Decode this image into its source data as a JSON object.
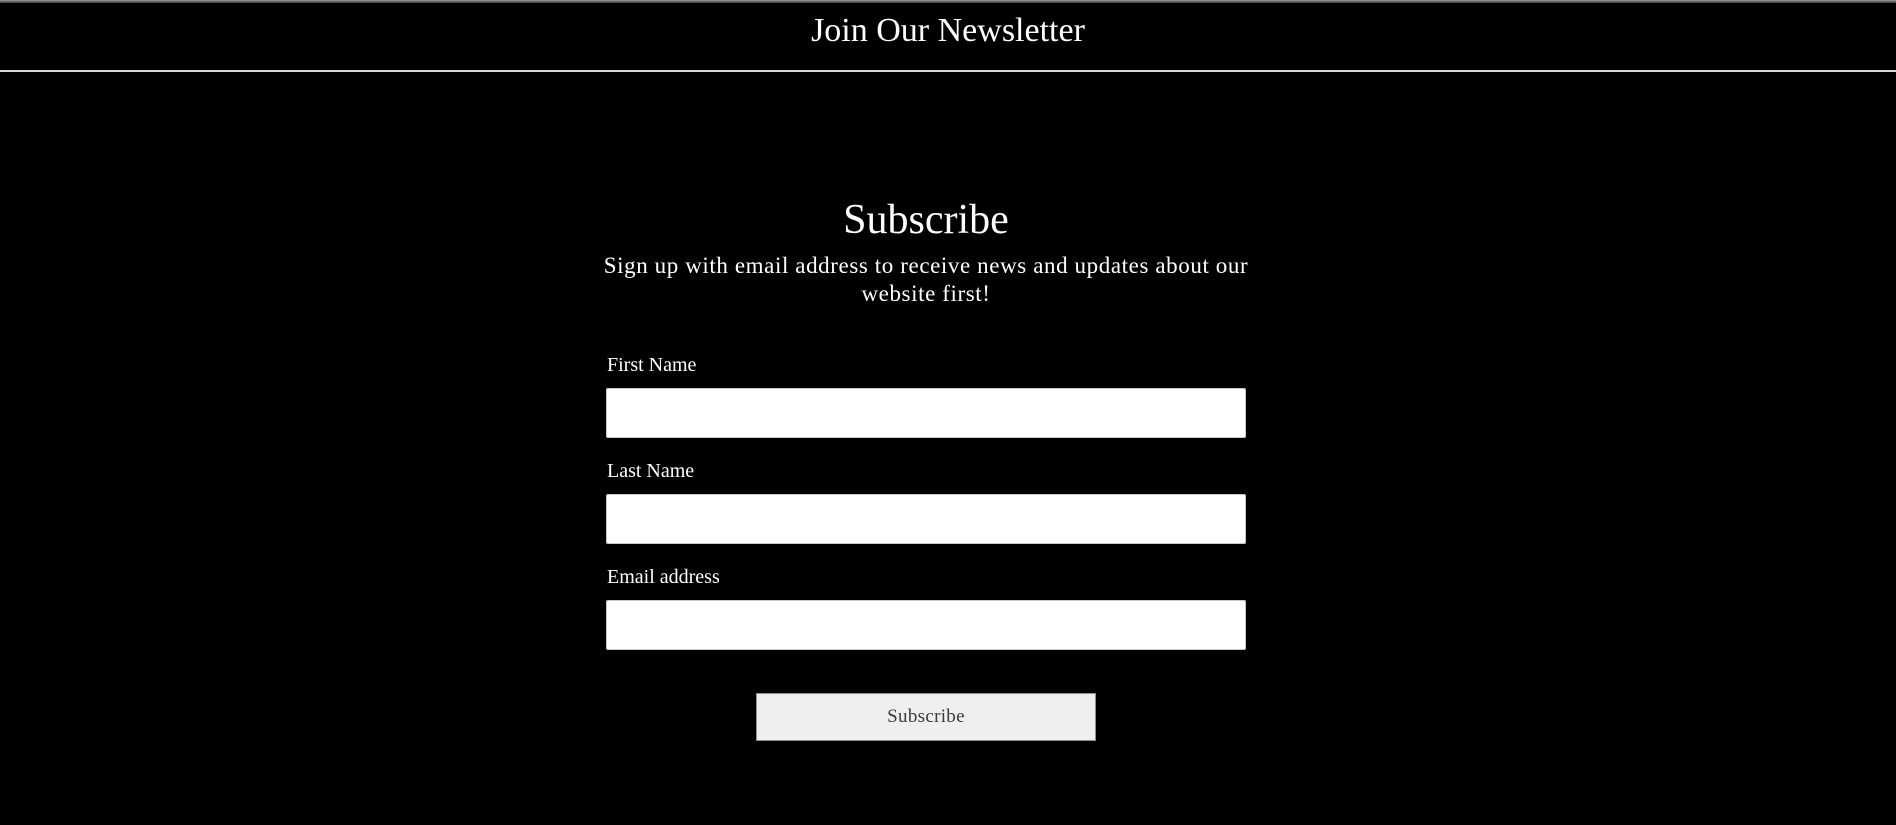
{
  "header": {
    "title": "Join Our Newsletter"
  },
  "subscribe_panel": {
    "title": "Subscribe",
    "subtitle": "Sign up with email address to receive news and updates about our website first!"
  },
  "form": {
    "fields": [
      {
        "label": "First Name",
        "value": "",
        "placeholder": ""
      },
      {
        "label": "Last Name",
        "value": "",
        "placeholder": ""
      },
      {
        "label": "Email address",
        "value": "",
        "placeholder": ""
      }
    ],
    "submit_label": "Subscribe"
  },
  "colors": {
    "background": "#000000",
    "text": "#ffffff",
    "input_background": "#ffffff",
    "button_background": "#efefef",
    "button_text": "#3a3a3a",
    "header_rule": "#d8d8d8"
  }
}
